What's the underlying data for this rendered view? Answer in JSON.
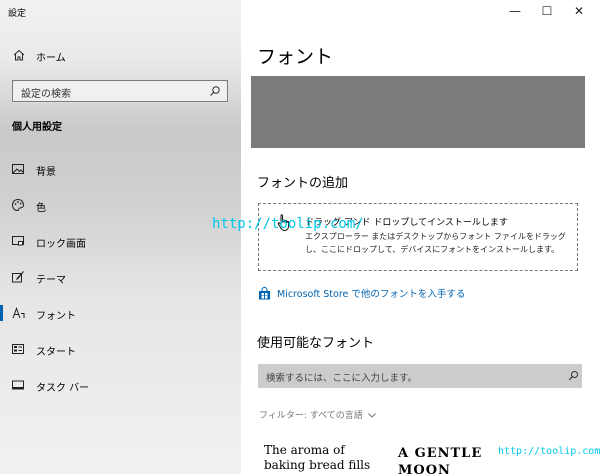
{
  "app": {
    "title": "設定"
  },
  "window_controls": {
    "minimize": "—",
    "maximize": "☐",
    "close": "✕"
  },
  "sidebar": {
    "home_label": "ホーム",
    "search_placeholder": "設定の検索",
    "section_title": "個人用設定",
    "items": [
      {
        "label": "背景",
        "icon": "image-icon"
      },
      {
        "label": "色",
        "icon": "palette-icon"
      },
      {
        "label": "ロック画面",
        "icon": "lock-screen-icon"
      },
      {
        "label": "テーマ",
        "icon": "theme-brush-icon"
      },
      {
        "label": "フォント",
        "icon": "font-icon",
        "selected": true
      },
      {
        "label": "スタート",
        "icon": "start-menu-icon"
      },
      {
        "label": "タスク バー",
        "icon": "taskbar-icon"
      }
    ]
  },
  "main": {
    "title": "フォント",
    "add_fonts_heading": "フォントの追加",
    "drop_zone": {
      "title": "ドラッグ アンド ドロップしてインストールします",
      "description": "エクスプローラー またはデスクトップからフォント ファイルをドラッグし、ここにドロップして、デバイスにフォントをインストールします。"
    },
    "store_link": "Microsoft Store で他のフォントを入手する",
    "available_heading": "使用可能なフォント",
    "font_search_placeholder": "検索するには、ここに入力します。",
    "filter_label": "フィルター: すべての言語",
    "samples": [
      {
        "text": "The aroma of baking bread fills the air"
      },
      {
        "text": "A GENTLE MOON LULLS"
      }
    ]
  },
  "watermarks": {
    "center": "http://toolip.com/",
    "corner": "http://toolip.com/"
  },
  "colors": {
    "accent": "#0063b1",
    "watermark": "#00c8e8"
  }
}
